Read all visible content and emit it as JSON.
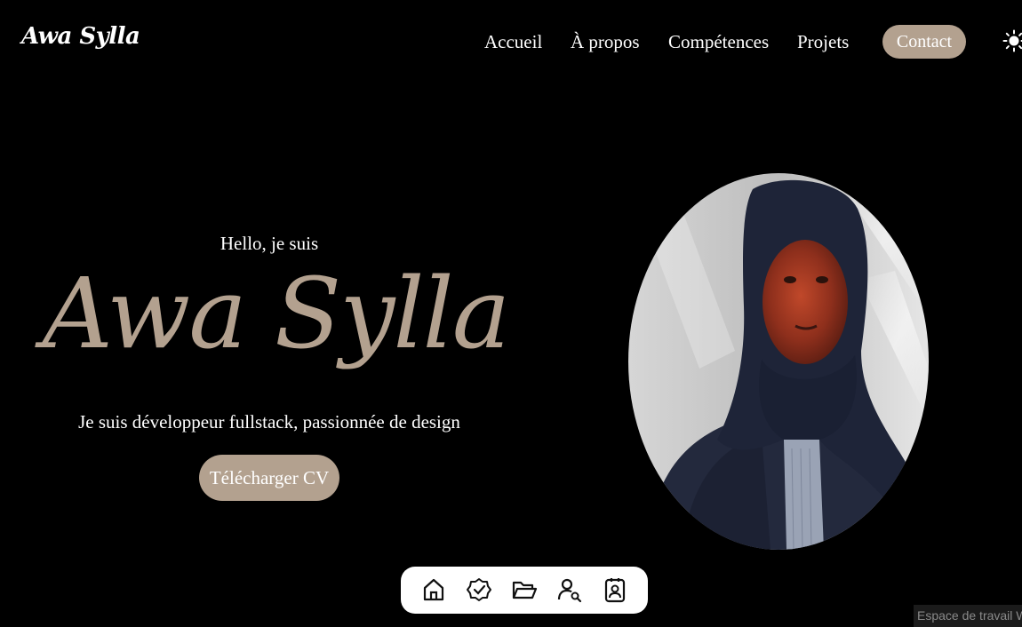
{
  "header": {
    "logo": "Awa Sylla",
    "nav": [
      "Accueil",
      "À propos",
      "Compétences",
      "Projets"
    ],
    "contact_label": "Contact",
    "theme_icon": "sun-icon"
  },
  "hero": {
    "greeting": "Hello, je suis",
    "name": "Awa Sylla",
    "subtitle": "Je suis développeur fullstack, passionnée de design",
    "cv_button": "Télécharger CV"
  },
  "portrait": {
    "icon": "profile-photo"
  },
  "dock": {
    "items": [
      "home-icon",
      "badge-check-icon",
      "folder-open-icon",
      "user-search-icon",
      "contact-card-icon"
    ]
  },
  "watermark": "Espace de travail Wis",
  "colors": {
    "background": "#000000",
    "accent": "#b3a18f",
    "text": "#ffffff",
    "dock": "#ffffff"
  }
}
